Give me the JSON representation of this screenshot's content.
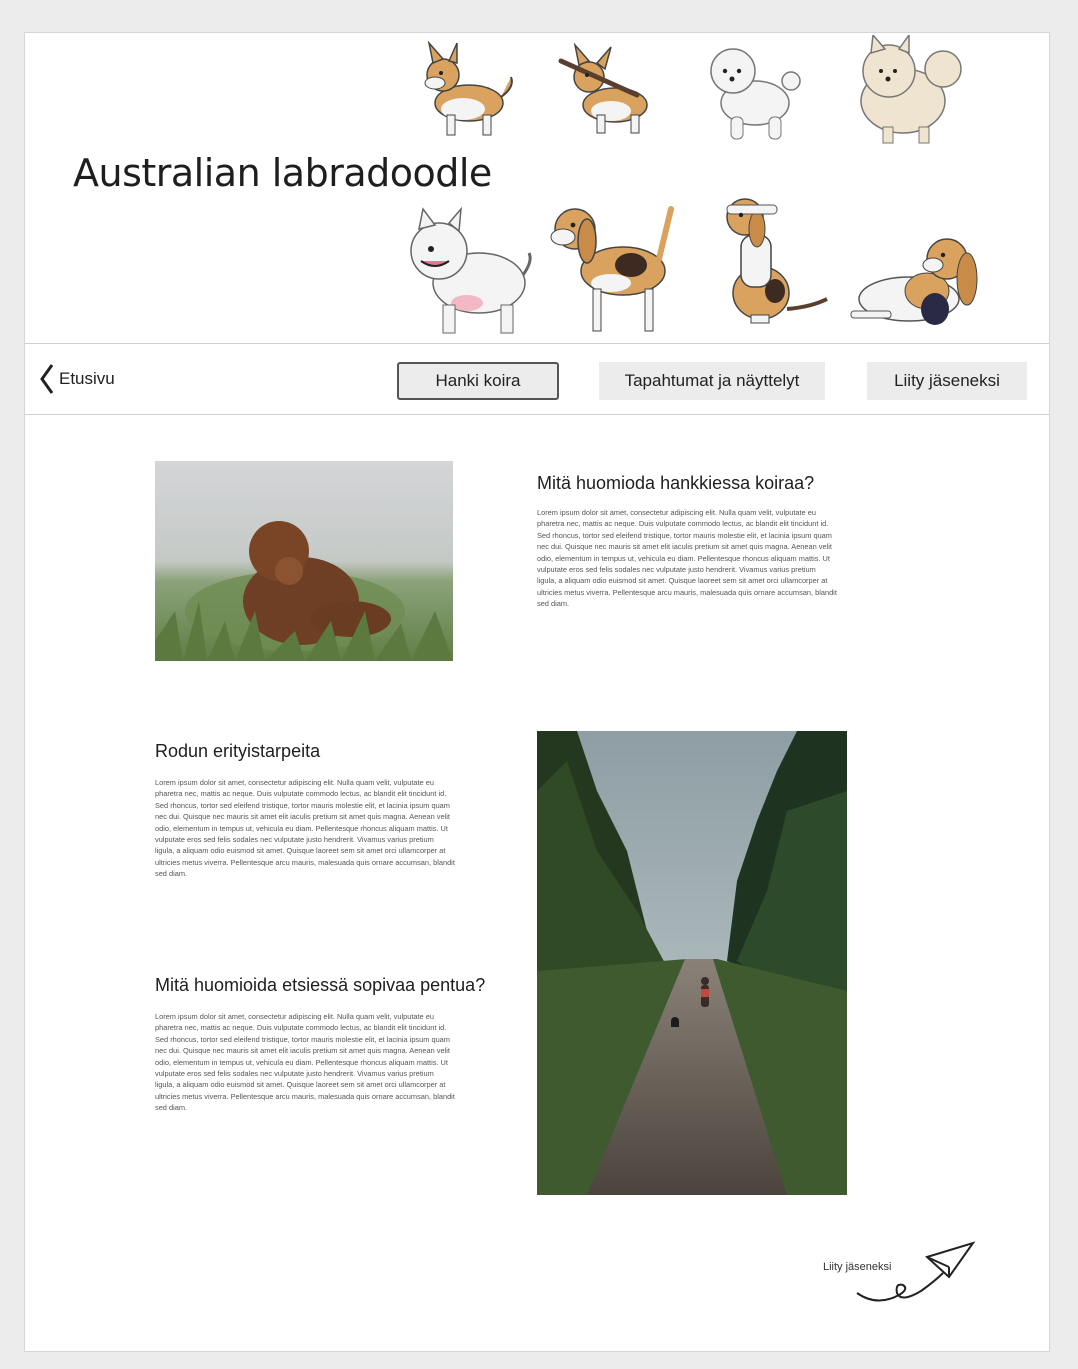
{
  "header": {
    "site_title": "Australian labradoodle"
  },
  "nav": {
    "back_label": "Etusivu",
    "buttons": [
      {
        "label": "Hanki koira",
        "active": true
      },
      {
        "label": "Tapahtumat ja näyttelyt",
        "active": false
      },
      {
        "label": "Liity jäseneksi",
        "active": false
      }
    ]
  },
  "sections": [
    {
      "title": "Mitä huomioda hankkiessa koiraa?",
      "body": "Lorem ipsum dolor sit amet, consectetur adipiscing elit. Nulla quam velit, vulputate eu pharetra nec, mattis ac neque. Duis vulputate commodo lectus, ac blandit elit tincidunt id. Sed rhoncus, tortor sed eleifend tristique, tortor mauris molestie elit, et lacinia ipsum quam nec dui. Quisque nec mauris sit amet elit iaculis pretium sit amet quis magna. Aenean velit odio, elementum in tempus ut, vehicula eu diam. Pellentesque rhoncus aliquam mattis. Ut vulputate eros sed felis sodales nec vulputate justo hendrerit. Vivamus varius pretium ligula, a aliquam odio euismod sit amet. Quisque laoreet sem sit amet orci ullamcorper at ultricies metus viverra. Pellentesque arcu mauris, malesuada quis ornare accumsan, blandit sed diam."
    },
    {
      "title": "Rodun erityistarpeita",
      "body": "Lorem ipsum dolor sit amet, consectetur adipiscing elit. Nulla quam velit, vulputate eu pharetra nec, mattis ac neque. Duis vulputate commodo lectus, ac blandit elit tincidunt id. Sed rhoncus, tortor sed eleifend tristique, tortor mauris molestie elit, et lacinia ipsum quam nec dui. Quisque nec mauris sit amet elit iaculis pretium sit amet quis magna. Aenean velit odio, elementum in tempus ut, vehicula eu diam. Pellentesque rhoncus aliquam mattis. Ut vulputate eros sed felis sodales nec vulputate justo hendrerit. Vivamus varius pretium ligula, a aliquam odio euismod sit amet. Quisque laoreet sem sit amet orci ullamcorper at ultricies metus viverra. Pellentesque arcu mauris, malesuada quis ornare accumsan, blandit sed diam."
    },
    {
      "title": "Mitä huomioida etsiessä sopivaa pentua?",
      "body": "Lorem ipsum dolor sit amet, consectetur adipiscing elit. Nulla quam velit, vulputate eu pharetra nec, mattis ac neque. Duis vulputate commodo lectus, ac blandit elit tincidunt id. Sed rhoncus, tortor sed eleifend tristique, tortor mauris molestie elit, et lacinia ipsum quam nec dui. Quisque nec mauris sit amet elit iaculis pretium sit amet quis magna. Aenean velit odio, elementum in tempus ut, vehicula eu diam. Pellentesque rhoncus aliquam mattis. Ut vulputate eros sed felis sodales nec vulputate justo hendrerit. Vivamus varius pretium ligula, a aliquam odio euismod sit amet. Quisque laoreet sem sit amet orci ullamcorper at ultricies metus viverra. Pellentesque arcu mauris, malesuada quis ornare accumsan, blandit sed diam."
    }
  ],
  "footer": {
    "join_label": "Liity jäseneksi"
  },
  "colors": {
    "page_bg": "#ececec",
    "card_bg": "#ffffff",
    "button_bg": "#ececec",
    "dog_tan": "#d9a35f",
    "dog_white": "#f4f4f4",
    "dog_dark": "#5a3f2e"
  }
}
